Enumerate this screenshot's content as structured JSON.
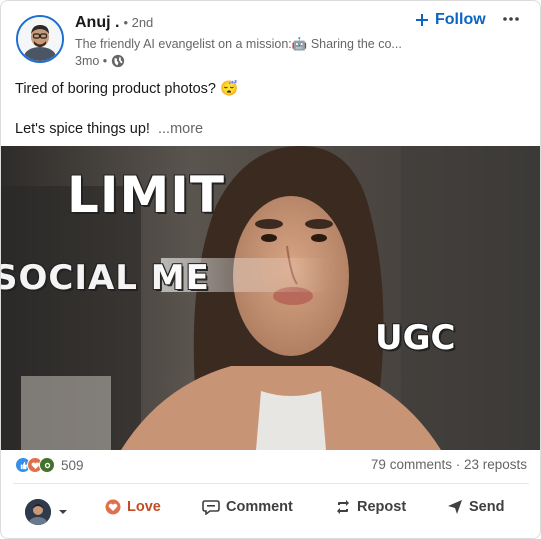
{
  "post": {
    "author": {
      "name": "Anuj .",
      "degree": "• 2nd",
      "tagline": "The friendly AI evangelist on a mission:🤖 Sharing the co...",
      "age": "3mo •"
    },
    "follow_label": "Follow",
    "more_icon": "ellipsis-icon",
    "text_line1": "Tired of boring product photos? 😴",
    "text_line2": "Let's spice things up!",
    "see_more": "...more",
    "media": {
      "overlay_limit": "LIMIT",
      "overlay_social": "SOCIAL ME",
      "overlay_ugc": "UGC"
    },
    "stats": {
      "reaction_count": "509",
      "comments_reposts": "79 comments · 23 reposts"
    },
    "actions": {
      "love": "Love",
      "comment": "Comment",
      "repost": "Repost",
      "send": "Send"
    }
  },
  "colors": {
    "accent": "#0a66c2",
    "love": "#c24d24",
    "avatar_ring": "#1e6fcf"
  }
}
